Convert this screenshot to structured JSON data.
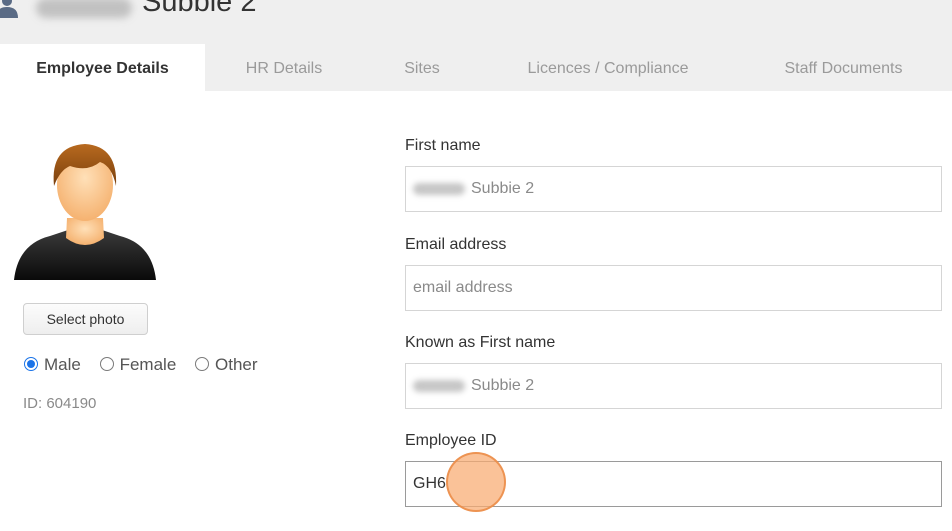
{
  "header": {
    "title": "Subbie 2"
  },
  "tabs": [
    {
      "label": "Employee Details"
    },
    {
      "label": "HR Details"
    },
    {
      "label": "Sites"
    },
    {
      "label": "Licences / Compliance"
    },
    {
      "label": "Staff Documents"
    }
  ],
  "left": {
    "select_photo_label": "Select photo",
    "gender_options": [
      "Male",
      "Female",
      "Other"
    ],
    "gender_selected": "Male",
    "id_text": "ID: 604190"
  },
  "form": {
    "first_name": {
      "label": "First name",
      "value": "Subbie 2"
    },
    "email": {
      "label": "Email address",
      "placeholder": "email address",
      "value": ""
    },
    "known_as": {
      "label": "Known as First name",
      "value": "Subbie 2"
    },
    "employee_id": {
      "label": "Employee ID",
      "value": "GH6"
    }
  },
  "colors": {
    "accent": "#1a73e8",
    "tab_bar_bg": "#efefef",
    "cursor_highlight": "#f8aa70"
  }
}
